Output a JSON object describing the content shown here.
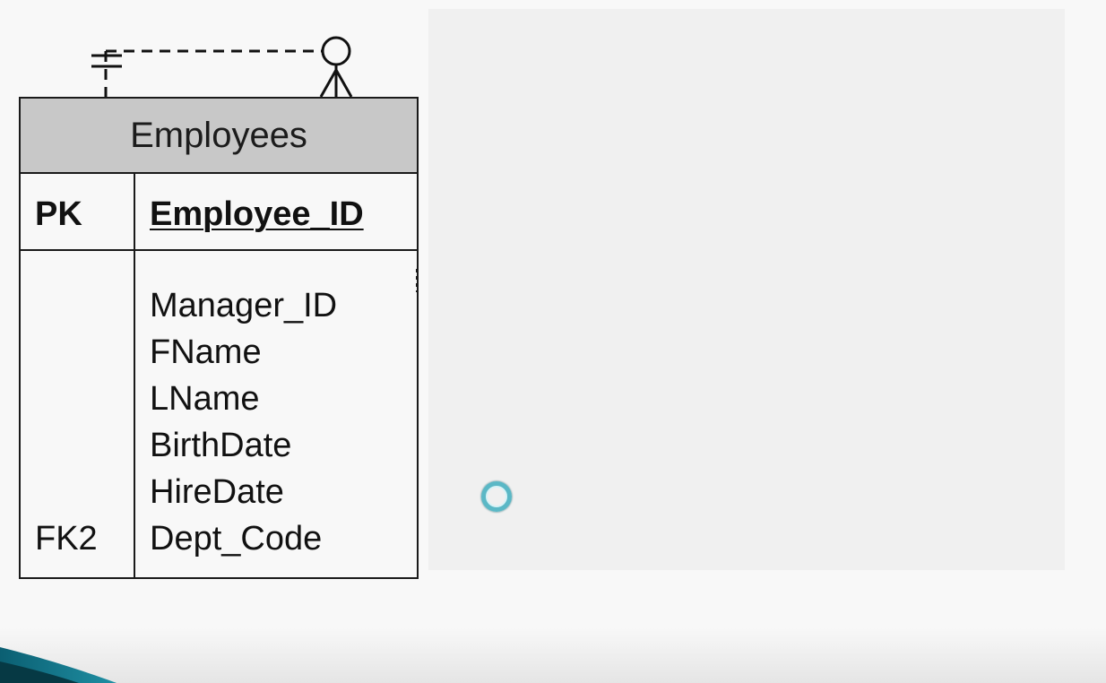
{
  "entity": {
    "name": "Employees",
    "primary_key": {
      "key": "PK",
      "field": "Employee_ID"
    },
    "attributes": [
      "Manager_ID",
      "FName",
      "LName",
      "BirthDate",
      "HireDate",
      "Dept_Code"
    ],
    "foreign_key": {
      "key": "FK2",
      "field": "Dept_Code"
    }
  },
  "relationship": {
    "type": "self-referencing",
    "line_style": "dashed",
    "start_notation": "one-and-only-one",
    "end_notation": "zero-or-many"
  },
  "icons": {
    "cursor": "loading-ring-icon"
  },
  "colors": {
    "header_fill": "#c8c8c8",
    "border": "#1a1a1a",
    "cursor_ring": "#5ab8c6"
  }
}
